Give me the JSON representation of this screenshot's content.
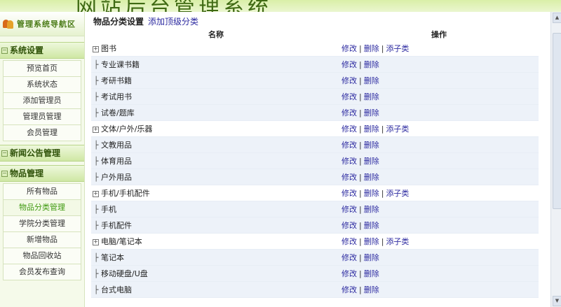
{
  "banner": {
    "title": "网站后台管理系统"
  },
  "sidebar": {
    "header": "管理系统导航区",
    "header_icon": "users-icon",
    "groups": [
      {
        "label": "系统设置",
        "items": [
          "预览首页",
          "系统状态",
          "添加管理员",
          "管理员管理",
          "会员管理"
        ]
      },
      {
        "label": "新闻公告管理",
        "items": []
      },
      {
        "label": "物品管理",
        "items": [
          "所有物品",
          "物品分类管理",
          "学院分类管理",
          "新增物品",
          "物品回收站",
          "会员发布查询"
        ]
      }
    ],
    "active_item": "物品分类管理"
  },
  "main": {
    "title": "物品分类设置",
    "add_top_link": "添加顶级分类",
    "col_name": "名称",
    "col_ops": "操作",
    "op_edit": "修改",
    "op_delete": "删除",
    "op_add_child": "添子类",
    "rows": [
      {
        "type": "parent",
        "name": "图书"
      },
      {
        "type": "child",
        "name": "专业课书籍"
      },
      {
        "type": "child",
        "name": "考研书籍"
      },
      {
        "type": "child",
        "name": "考试用书"
      },
      {
        "type": "child",
        "name": "试卷/题库"
      },
      {
        "type": "parent",
        "name": "文体/户外/乐器"
      },
      {
        "type": "child",
        "name": "文教用品"
      },
      {
        "type": "child",
        "name": "体育用品"
      },
      {
        "type": "child",
        "name": "户外用品"
      },
      {
        "type": "parent",
        "name": "手机/手机配件"
      },
      {
        "type": "child",
        "name": "手机"
      },
      {
        "type": "child",
        "name": "手机配件"
      },
      {
        "type": "parent",
        "name": "电脑/笔记本"
      },
      {
        "type": "child",
        "name": "笔记本"
      },
      {
        "type": "child",
        "name": "移动硬盘/U盘"
      },
      {
        "type": "child",
        "name": "台式电脑"
      }
    ]
  },
  "colors": {
    "accent_green": "#3f9a10",
    "link_blue": "#2c2aa0",
    "child_row_bg": "#edf2f9"
  }
}
